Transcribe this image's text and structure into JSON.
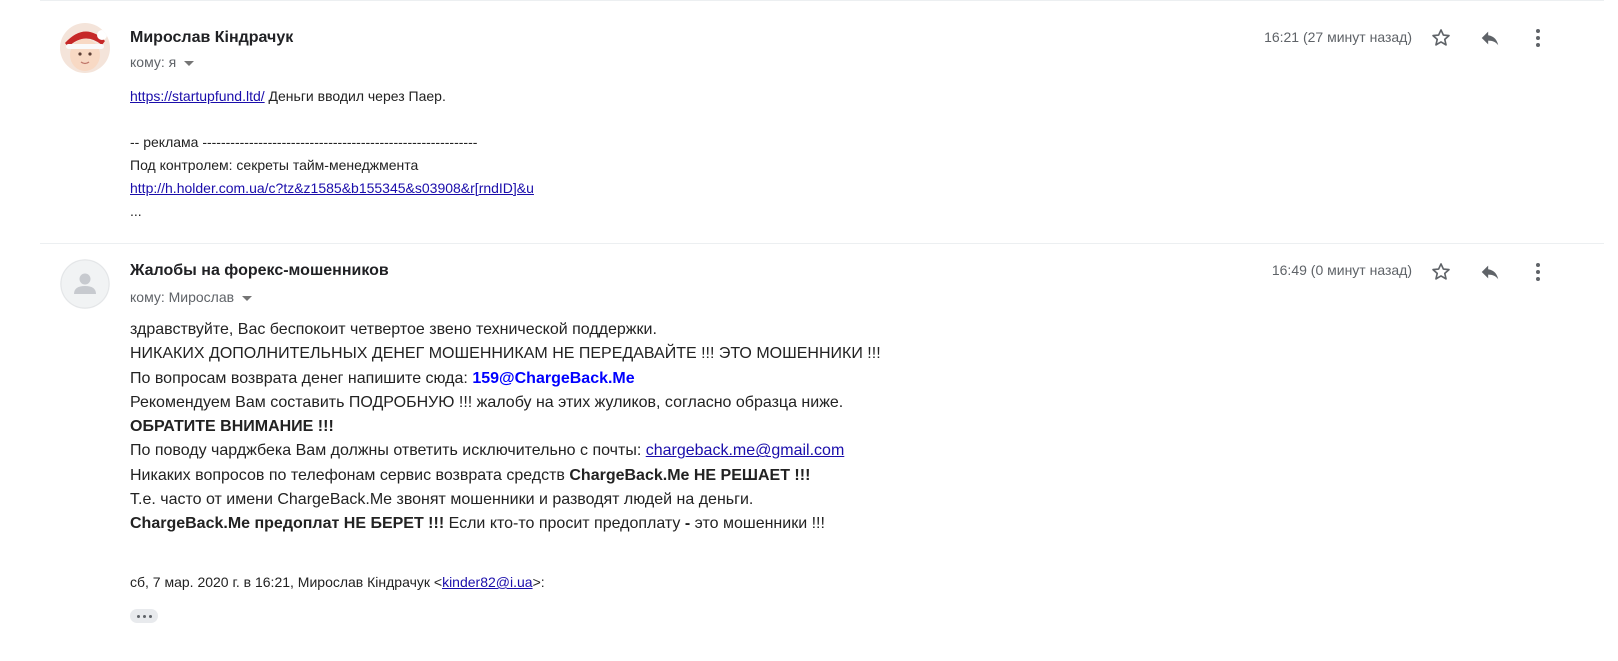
{
  "messages": [
    {
      "sender": "Мирослав Кіндрачук",
      "to": "кому: я",
      "time": "16:21 (27 минут назад)",
      "body": {
        "link1": "https://startupfund.ltd/",
        "text1": " Деньги вводил через Паер.",
        "ad_line": "-- реклама -----------------------------------------------------------",
        "ad_title": "Под контролем: секреты тайм-менеджмента",
        "ad_link": "http://h.holder.com.ua/c?tz&z1585&b155345&s03908&r[rndID]&u",
        "ellipsis": "..."
      }
    },
    {
      "sender": "Жалобы на форекс-мошенников",
      "to": "кому: Мирослав",
      "time": "16:49 (0 минут назад)",
      "body": {
        "l1": "здравствуйте, Вас беспокоит четвертое звено технической поддержки.",
        "l2": "НИКАКИХ ДОПОЛНИТЕЛЬНЫХ ДЕНЕГ МОШЕННИКАМ НЕ ПЕРЕДАВАЙТЕ !!! ЭТО МОШЕННИКИ !!!",
        "l3_prefix": "По вопросам возврата денег напишите сюда: ",
        "l3_email": "159@ChargeBack.Me",
        "l4": "Рекомендуем Вам составить ПОДРОБНУЮ !!! жалобу на этих жуликов, согласно образца ниже.",
        "l5": "ОБРАТИТЕ ВНИМАНИЕ !!!",
        "l6_prefix": "По поводу чарджбека Вам должны ответить исключительно с почты: ",
        "l6_email": "chargeback.me@gmail.com",
        "l7_prefix": "Никаких вопросов по телефонам сервис возврата средств ",
        "l7_bold": "ChargeBack.Me НЕ РЕШАЕТ !!!",
        "l8": "Т.е. часто от имени ChargeBack.Me звонят мошенники и разводят людей на деньги.",
        "l9_bold": "ChargeBack.Me предоплат НЕ БЕРЕТ !!!",
        "l9_mid": " Если кто-то просит предоплату ",
        "l9_dash": "-",
        "l9_suffix": " это мошенники !!!"
      },
      "quote": {
        "prefix": "сб, 7 мар. 2020 г. в 16:21, Мирослав Кіндрачук <",
        "email": "kinder82@i.ua",
        "suffix": ">:"
      }
    }
  ],
  "icons": {
    "star": "star-icon",
    "reply": "reply-icon",
    "more": "more-vert-icon",
    "expand": "more-horiz-icon"
  },
  "colors": {
    "link": "#1a0dab",
    "highlight_email": "#0000ff",
    "muted": "#5f6368"
  }
}
